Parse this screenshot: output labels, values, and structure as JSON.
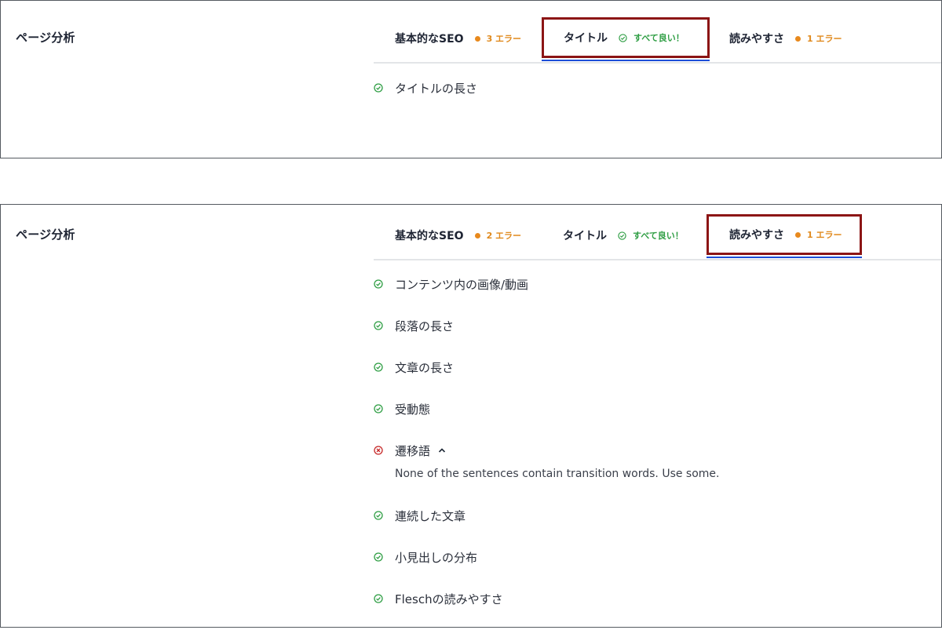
{
  "top_panel": {
    "title": "ページ分析",
    "tabs": [
      {
        "label": "基本的なSEO",
        "status": "3 エラー",
        "status_type": "warning"
      },
      {
        "label": "タイトル",
        "status": "すべて良い！",
        "status_type": "good"
      },
      {
        "label": "読みやすさ",
        "status": "1 エラー",
        "status_type": "warning"
      }
    ],
    "active_tab": "タイトル",
    "items": [
      {
        "label": "タイトルの長さ",
        "state": "pass"
      }
    ]
  },
  "bottom_panel": {
    "title": "ページ分析",
    "tabs": [
      {
        "label": "基本的なSEO",
        "status": "2 エラー",
        "status_type": "warning"
      },
      {
        "label": "タイトル",
        "status": "すべて良い！",
        "status_type": "good"
      },
      {
        "label": "読みやすさ",
        "status": "1 エラー",
        "status_type": "warning"
      }
    ],
    "active_tab": "読みやすさ",
    "items": [
      {
        "label": "コンテンツ内の画像/動画",
        "state": "pass"
      },
      {
        "label": "段落の長さ",
        "state": "pass"
      },
      {
        "label": "文章の長さ",
        "state": "pass"
      },
      {
        "label": "受動態",
        "state": "pass"
      },
      {
        "label": "遷移語",
        "state": "fail",
        "expanded": true,
        "detail": "None of the sentences contain transition words. Use some."
      },
      {
        "label": "連続した文章",
        "state": "pass"
      },
      {
        "label": "小見出しの分布",
        "state": "pass"
      },
      {
        "label": "Fleschの読みやすさ",
        "state": "pass"
      }
    ]
  },
  "colors": {
    "warning": "#e08a1e",
    "good": "#2f9e44",
    "error": "#c62828",
    "active_underline": "#1d4fd8",
    "highlight_box": "#8c1515"
  },
  "icons": {
    "warning": "dot-icon",
    "good": "check-circle-icon",
    "pass": "check-circle-icon",
    "fail": "x-circle-icon",
    "expanded": "chevron-up-icon"
  }
}
